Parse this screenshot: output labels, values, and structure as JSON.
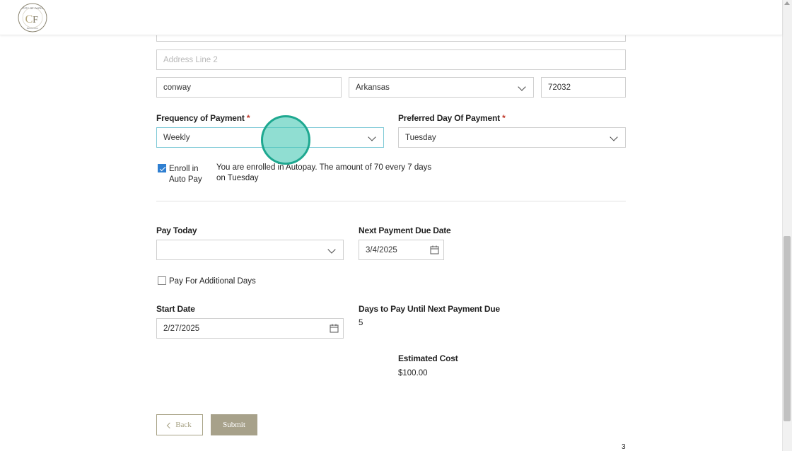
{
  "header": {
    "logo_alt": "CITY OF FAITH",
    "logo_tagline": "BEHAVIORAL SERVICES"
  },
  "address": {
    "line2_placeholder": "Address Line 2",
    "city": "conway",
    "state": "Arkansas",
    "zip": "72032"
  },
  "frequency": {
    "label": "Frequency of Payment",
    "required": "*",
    "value": "Weekly"
  },
  "preferred_day": {
    "label": "Preferred Day Of Payment",
    "required": "*",
    "value": "Tuesday"
  },
  "autopay": {
    "label_line1": "Enroll in",
    "label_line2": "Auto Pay",
    "checked": true,
    "message_line1": "You are enrolled in Autopay. The amount of 70 every 7 days",
    "message_line2": "on Tuesday"
  },
  "pay_today": {
    "label": "Pay Today",
    "value": ""
  },
  "next_due": {
    "label": "Next Payment Due Date",
    "value": "3/4/2025"
  },
  "additional_days": {
    "label": "Pay For Additional Days",
    "checked": false
  },
  "start_date": {
    "label": "Start Date",
    "value": "2/27/2025"
  },
  "days_to_pay": {
    "label": "Days to Pay Until Next Payment Due",
    "value": "5"
  },
  "estimated_cost": {
    "label": "Estimated Cost",
    "value": "$100.00"
  },
  "buttons": {
    "back": "Back",
    "submit": "Submit"
  },
  "page_number": "3",
  "colors": {
    "accent": "#a7a18a",
    "checkbox": "#2f7fd1",
    "cursor": "#1ea890",
    "required": "#c0392b"
  }
}
